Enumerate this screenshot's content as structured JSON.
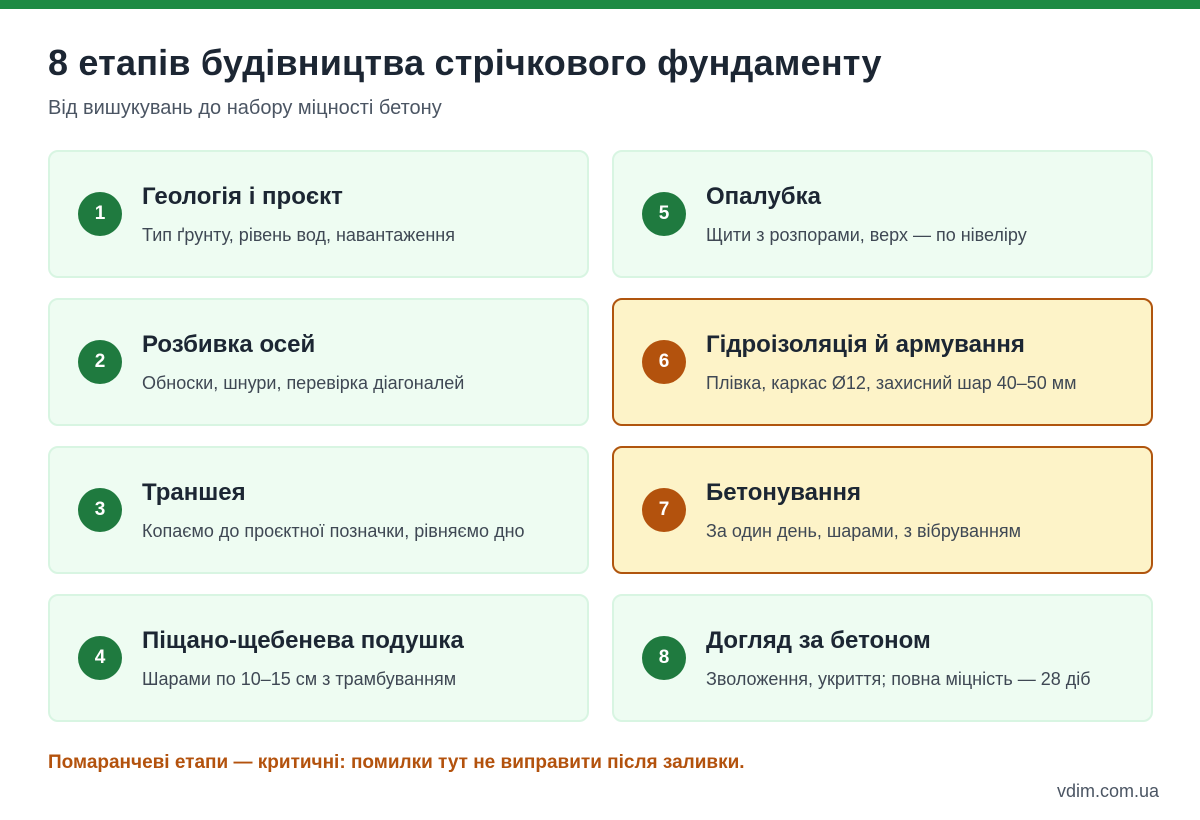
{
  "title": "8 етапів будівництва стрічкового фундаменту",
  "subtitle": "Від вишукувань до набору міцності бетону",
  "colors": {
    "accent_green": "#1e8a44",
    "card_bg": "#eefcf2",
    "critical_bg": "#fdf3c8",
    "critical_accent": "#b3520d"
  },
  "steps": [
    {
      "number": "1",
      "title": "Геологія і проєкт",
      "description": "Тип ґрунту, рівень вод, навантаження",
      "critical": false
    },
    {
      "number": "2",
      "title": "Розбивка осей",
      "description": "Обноски, шнури, перевірка діагоналей",
      "critical": false
    },
    {
      "number": "3",
      "title": "Траншея",
      "description": "Копаємо до проєктної позначки, рівняємо дно",
      "critical": false
    },
    {
      "number": "4",
      "title": "Піщано-щебенева подушка",
      "description": "Шарами по 10–15 см з трамбуванням",
      "critical": false
    },
    {
      "number": "5",
      "title": "Опалубка",
      "description": "Щити з розпорами, верх — по нівеліру",
      "critical": false
    },
    {
      "number": "6",
      "title": "Гідроізоляція й армування",
      "description": "Плівка, каркас Ø12, захисний шар 40–50 мм",
      "critical": true
    },
    {
      "number": "7",
      "title": "Бетонування",
      "description": "За один день, шарами, з вібруванням",
      "critical": true
    },
    {
      "number": "8",
      "title": "Догляд за бетоном",
      "description": "Зволоження, укриття; повна міцність — 28 діб",
      "critical": false
    }
  ],
  "note": "Помаранчеві етапи — критичні: помилки тут не виправити після заливки.",
  "source": "vdim.com.ua"
}
